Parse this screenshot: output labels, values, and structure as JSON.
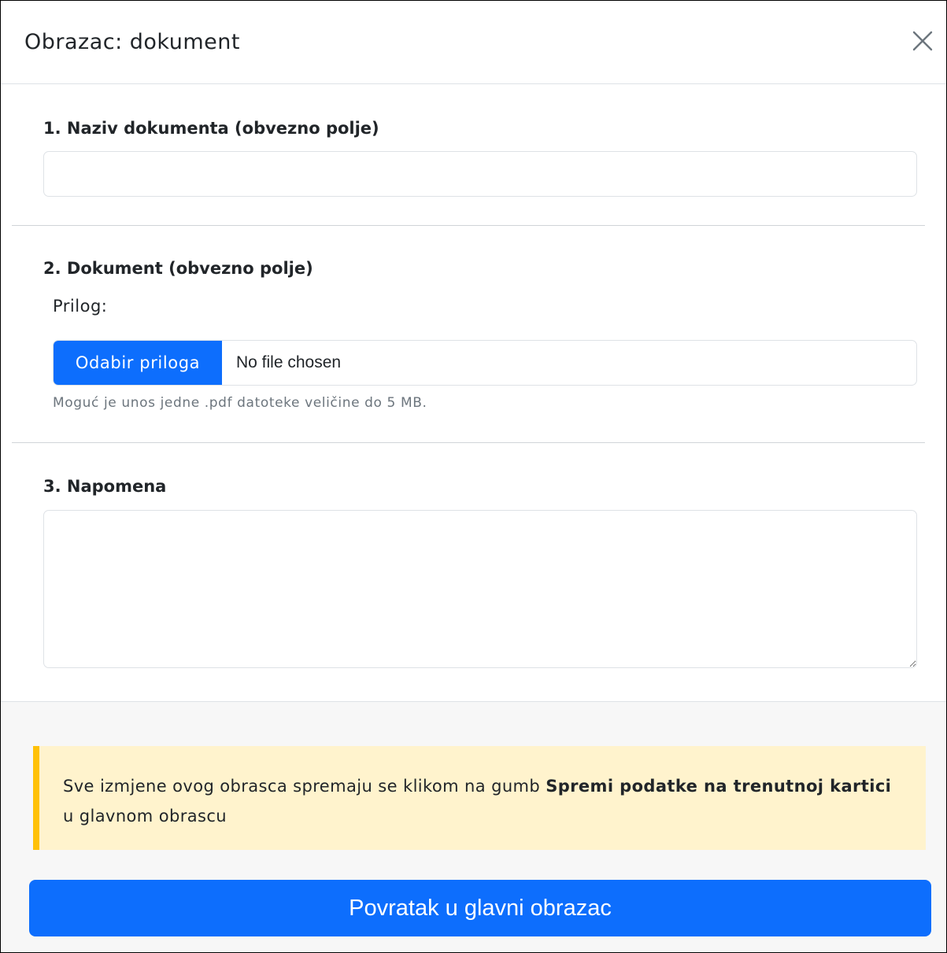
{
  "modal": {
    "title": "Obrazac: dokument",
    "close_icon": "close-icon"
  },
  "fields": {
    "naziv": {
      "heading": "1. Naziv dokumenta (obvezno polje)",
      "value": ""
    },
    "dokument": {
      "heading": "2. Dokument (obvezno polje)",
      "label": "Prilog:",
      "button_label": "Odabir priloga",
      "file_status": "No file chosen",
      "help": "Moguć je unos jedne .pdf datoteke veličine do 5 MB."
    },
    "napomena": {
      "heading": "3. Napomena",
      "value": ""
    }
  },
  "footer": {
    "alert_part1": "Sve izmjene ovog obrasca spremaju se klikom na gumb ",
    "alert_bold": "Spremi podatke na trenutnoj kartici",
    "alert_part2": " u glavnom obrascu",
    "button_label": "Povratak u glavni obrazac"
  },
  "colors": {
    "primary": "#0d6efd",
    "alert_background": "#fff3cd",
    "alert_border": "#ffc107",
    "footer_background": "#f7f7f7"
  }
}
